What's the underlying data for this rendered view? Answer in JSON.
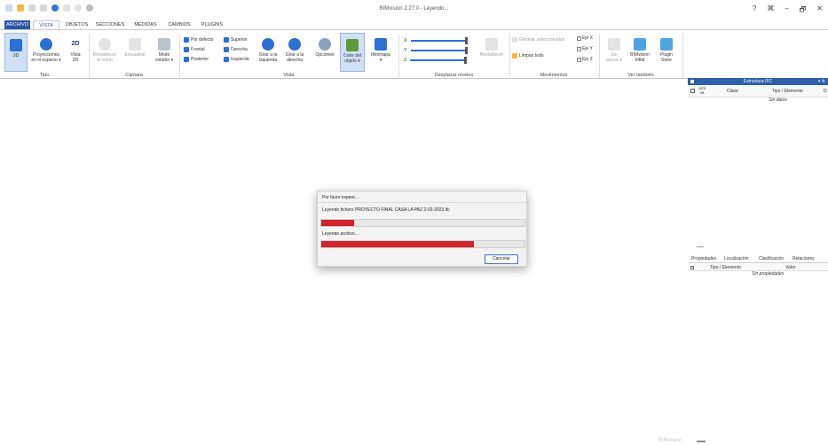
{
  "window": {
    "title": "BIMvision 2.27.0 - Leyendo...",
    "controls": [
      "?",
      "⌘",
      "–",
      "🗗",
      "✕"
    ]
  },
  "tabs": [
    "ARCHIVO",
    "VISTA",
    "OBJETOS",
    "SECCIONES",
    "MEDIDAS",
    "CAMBIOS",
    "PLUGINS"
  ],
  "ribbon": {
    "tipo": {
      "b3d": "3D",
      "proy_line1": "Proyecciones",
      "proy_line2": "en el espacio ▾",
      "vista2d_line1": "Vista",
      "vista2d_line2": "2D",
      "vista2d_icon": "2D",
      "label": "Tipo"
    },
    "camara": {
      "reset_line1": "Restablecer",
      "reset_line2": "el zoom",
      "encuadrar": "Encuadrar",
      "modo_line1": "Modo",
      "modo_line2": "volador ▾",
      "label": "Cámara"
    },
    "vista": {
      "por_defecto": "Por defecto",
      "frontal": "Frontal",
      "posterior": "Posterior",
      "superior": "Superior",
      "derecha": "Derecha",
      "izquierda": "Izquierda",
      "girar_izq_line1": "Girar a la",
      "girar_izq_line2": "izquierda",
      "girar_der_line1": "Girar a la",
      "girar_der_line2": "derecha",
      "label": "Vista"
    },
    "opciones": "Opciones",
    "color_line1": "Color del",
    "color_line2": "objeto ▾",
    "minimapa_line1": "Minimapa",
    "minimapa_line2": "▾",
    "desplazar": {
      "x": "X",
      "y": "Y",
      "z": "Z",
      "restablecer": "Restablecer",
      "label": "Desplazar niveles"
    },
    "movimientos": {
      "eliminar": "Eliminar seleccionados",
      "limpiar": "Limpiar todo",
      "eje_x": "Eje X",
      "eje_y": "Eje Y",
      "eje_z": "Eje Z",
      "label": "Movimientos"
    },
    "ver": {
      "sin_line1": "Sin",
      "sin_line2": "avisos ▾",
      "bim_line1": "BIMvision",
      "bim_line2": "64bit",
      "plugin_line1": "Plugin",
      "plugin_line2": "Store",
      "label": "Ver también"
    }
  },
  "ifc_panel": {
    "title": "Estructura IFC",
    "header_pin": "▾ ⇅",
    "col_activa_line1": "Acti",
    "col_activa_line2": "va",
    "col_clase": "Clase",
    "col_tipo": "Tipo / Elemento",
    "col_extra": "D",
    "empty": "Sin datos"
  },
  "props_panel": {
    "tabs": [
      "Propiedades",
      "Localización",
      "Clasificación",
      "Relaciones"
    ],
    "col_tipo": "Tipo / Elemento",
    "col_valor": "Valor",
    "empty": "Sin propiedades"
  },
  "dialog": {
    "title": "Por favor espere...",
    "line1": "Leyendo fichero PROYECTO FINAL CASA LA PAZ 2-02-2023.ifc",
    "progress1": 0.16,
    "line2": "Leyendo archivo...",
    "progress2": 0.75,
    "cancel": "Cancelar"
  },
  "status": {
    "watermark": "BIMvision"
  },
  "colors": {
    "accent": "#2b57a8",
    "progress": "#d2222a",
    "panel_header": "#2e5fa8"
  }
}
